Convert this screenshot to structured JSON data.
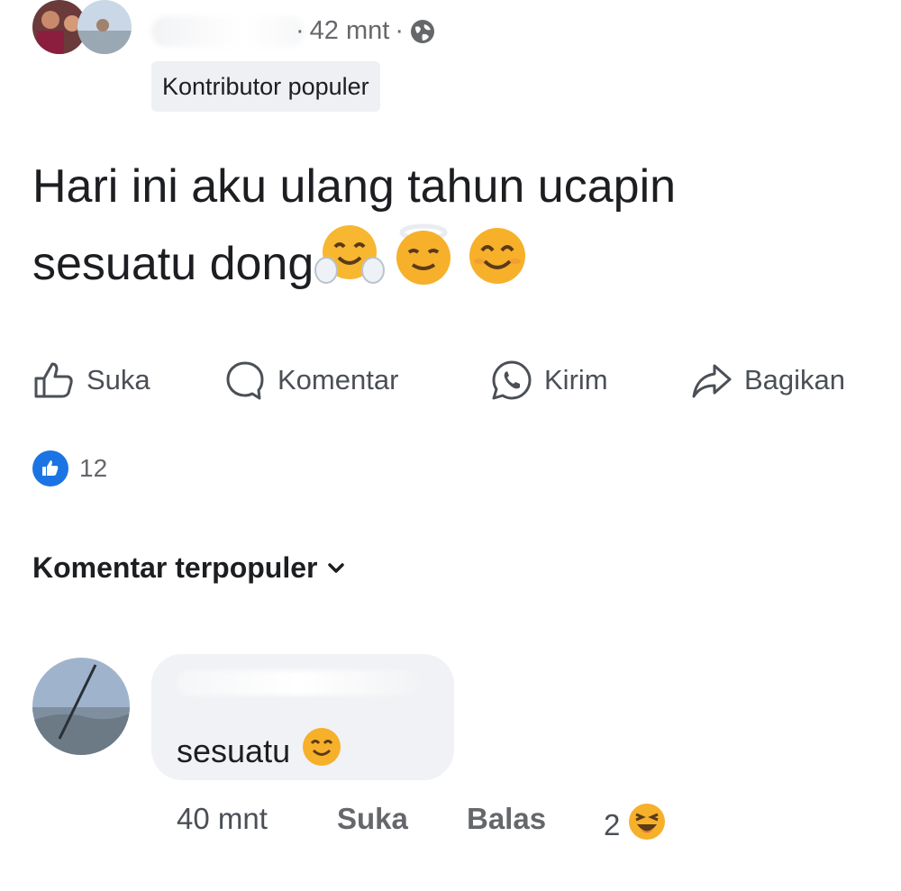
{
  "post": {
    "time": "42 mnt",
    "separator": "·",
    "badge": "Kontributor populer",
    "text_line1": "Hari ini aku ulang tahun ucapin",
    "text_line2": "sesuatu dong"
  },
  "actions": {
    "like": "Suka",
    "comment": "Komentar",
    "send": "Kirim",
    "share": "Bagikan"
  },
  "reactions": {
    "count": "12"
  },
  "comments_header": {
    "sort_label": "Komentar terpopuler"
  },
  "comment": {
    "text": "sesuatu",
    "time": "40 mnt",
    "like": "Suka",
    "reply": "Balas",
    "reaction_count": "2"
  }
}
